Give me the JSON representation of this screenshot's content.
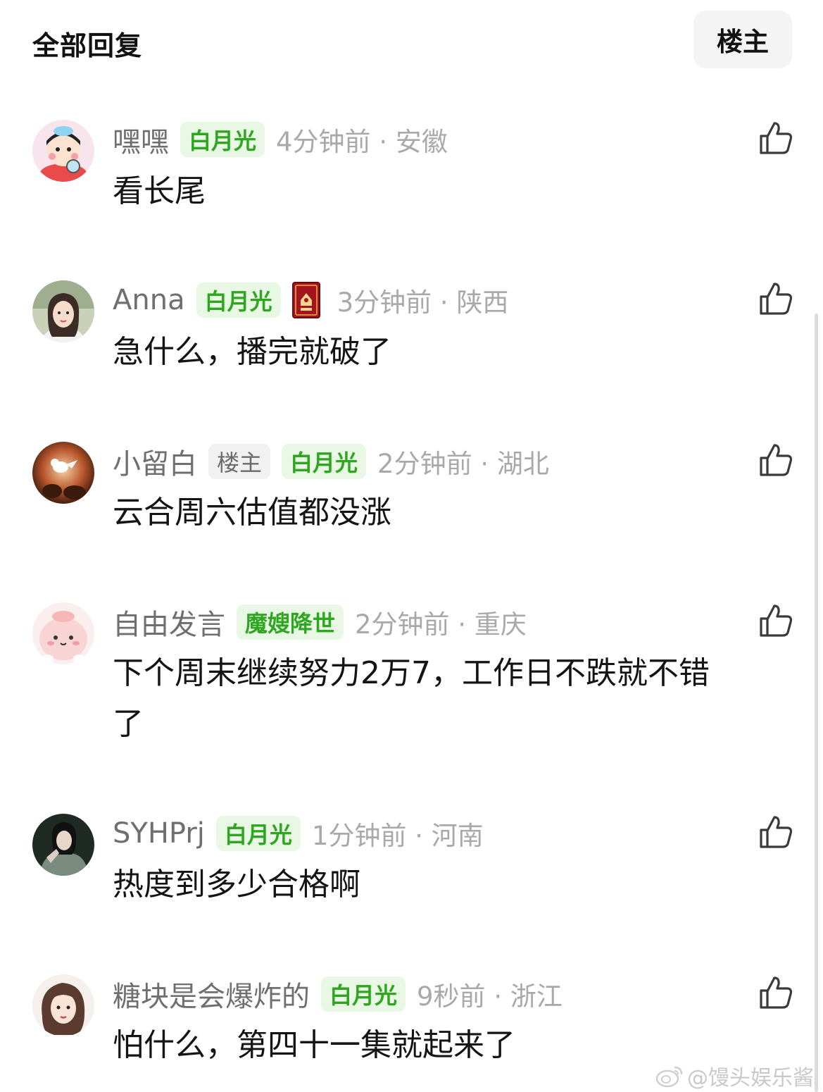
{
  "header": {
    "title": "全部回复",
    "filter_label": "楼主"
  },
  "comments": [
    {
      "username": "嘿嘿",
      "badges": [
        "白月光"
      ],
      "time": "4分钟前",
      "location": "安徽",
      "content": "看长尾"
    },
    {
      "username": "Anna",
      "badges": [
        "白月光"
      ],
      "time": "3分钟前",
      "location": "陕西",
      "content": "急什么，播完就破了"
    },
    {
      "username": "小留白",
      "owner_badge": "楼主",
      "badges": [
        "白月光"
      ],
      "time": "2分钟前",
      "location": "湖北",
      "content": "云合周六估值都没涨"
    },
    {
      "username": "自由发言",
      "badges": [
        "魔嫂降世"
      ],
      "time": "2分钟前",
      "location": "重庆",
      "content_lines": [
        "下个周末继续努力2万7，工作日不跌就不错",
        "了"
      ]
    },
    {
      "username": "SYHPrj",
      "badges": [
        "白月光"
      ],
      "time": "1分钟前",
      "location": "河南",
      "content": "热度到多少合格啊"
    },
    {
      "username": "糖块是会爆炸的",
      "badges": [
        "白月光"
      ],
      "time": "9秒前",
      "location": "浙江",
      "content": "怕什么，第四十一集就起来了"
    }
  ],
  "meta_separator": "·",
  "watermark": "@馒头娱乐酱",
  "icons": {
    "like": "thumbs-up-icon",
    "watermark": "weibo-logo-icon"
  },
  "colors": {
    "badge_text": "#2fa61f",
    "badge_bg": "#e9f7e5",
    "username": "#6f6f6f",
    "meta": "#a9a9a9"
  }
}
